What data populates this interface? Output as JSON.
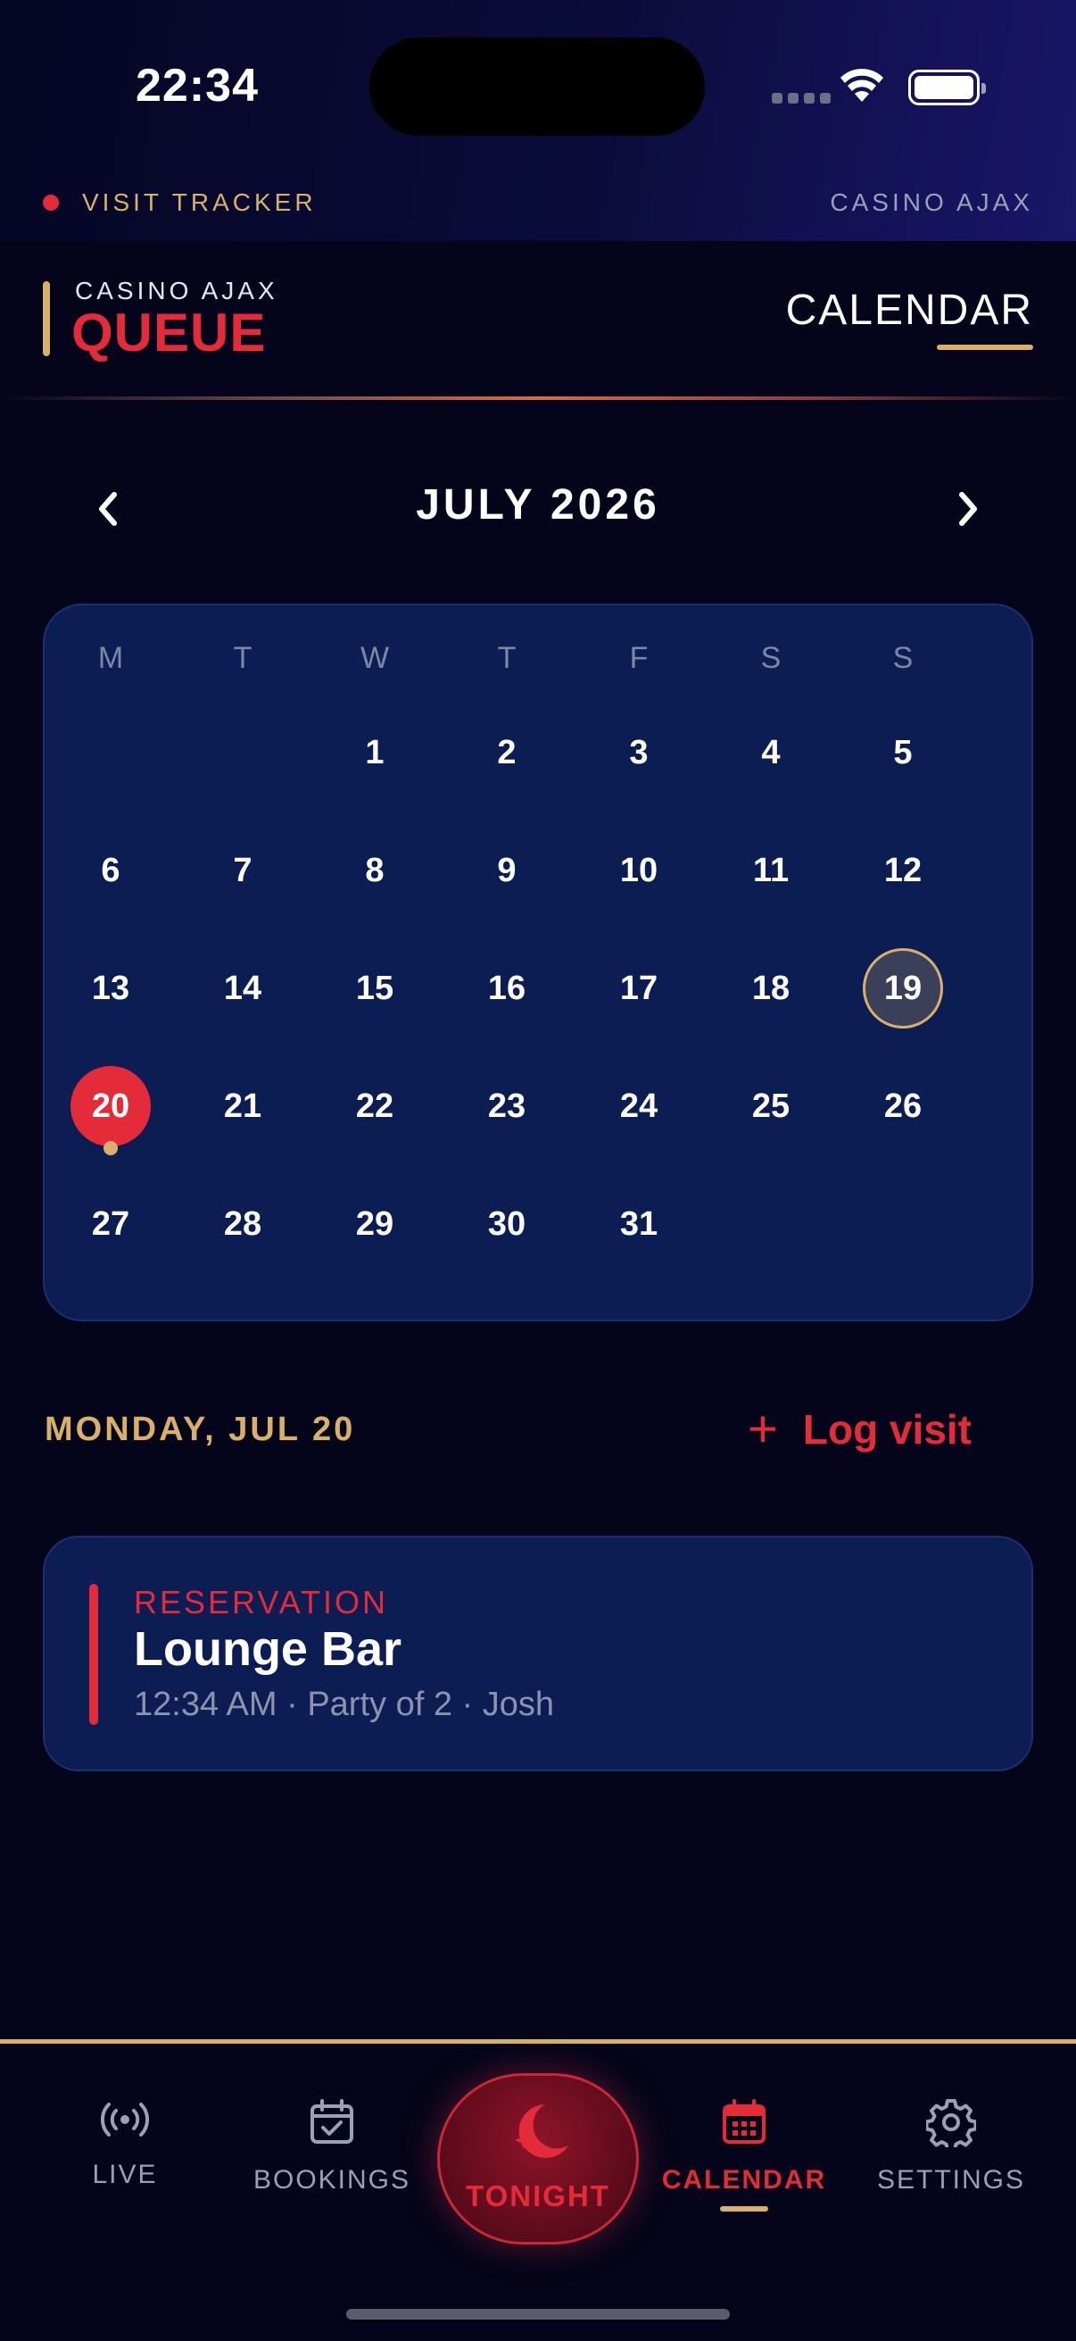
{
  "status": {
    "time": "22:34"
  },
  "tracker": {
    "label": "VISIT TRACKER",
    "venue": "CASINO AJAX"
  },
  "header": {
    "brand_sub": "CASINO AJAX",
    "brand_main": "QUEUE",
    "title": "CALENDAR"
  },
  "calendar": {
    "month_title": "JULY 2026",
    "weekdays": [
      "M",
      "T",
      "W",
      "T",
      "F",
      "S",
      "S"
    ],
    "days": [
      "1",
      "2",
      "3",
      "4",
      "5",
      "6",
      "7",
      "8",
      "9",
      "10",
      "11",
      "12",
      "13",
      "14",
      "15",
      "16",
      "17",
      "18",
      "19",
      "20",
      "21",
      "22",
      "23",
      "24",
      "25",
      "26",
      "27",
      "28",
      "29",
      "30",
      "31"
    ],
    "today": "19",
    "selected": "20"
  },
  "selection": {
    "date_label": "MONDAY, JUL 20",
    "log_plus": "+",
    "log_label": "Log visit"
  },
  "event": {
    "type": "RESERVATION",
    "title": "Lounge Bar",
    "meta": "12:34 AM · Party of 2 · Josh"
  },
  "tabs": {
    "live": "LIVE",
    "bookings": "BOOKINGS",
    "tonight": "TONIGHT",
    "calendar": "CALENDAR",
    "settings": "SETTINGS"
  },
  "colors": {
    "accent_red": "#e32b3a",
    "accent_gold": "#d9b06a",
    "card_blue": "#0b1d52",
    "background": "#04051a"
  }
}
